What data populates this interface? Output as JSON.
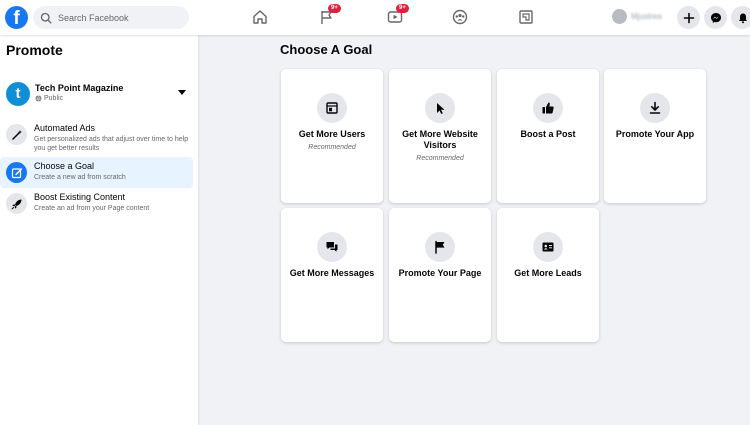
{
  "topbar": {
    "search_placeholder": "Search Facebook",
    "logo_letter": "f",
    "notifications_pages": "9+",
    "notifications_watch": "9+",
    "profile_name": "Mjustrea",
    "accent": "#1877f2"
  },
  "sidebar": {
    "title": "Promote",
    "page": {
      "name": "Tech Point Magazine",
      "avatar_letter": "t",
      "visibility": "Public"
    },
    "items": [
      {
        "label": "Automated Ads",
        "desc": "Get personalized ads that adjust over time to help you get better results",
        "icon": "wand-icon"
      },
      {
        "label": "Choose a Goal",
        "desc": "Create a new ad from scratch",
        "icon": "edit-icon"
      },
      {
        "label": "Boost Existing Content",
        "desc": "Create an ad from your Page content",
        "icon": "rocket-icon"
      }
    ]
  },
  "main": {
    "title": "Choose A Goal",
    "cards": [
      {
        "label": "Get More Users",
        "note": "Recommended",
        "icon": "app-window-icon"
      },
      {
        "label": "Get More Website Visitors",
        "note": "Recommended",
        "icon": "cursor-icon"
      },
      {
        "label": "Boost a Post",
        "note": "",
        "icon": "thumbs-up-icon"
      },
      {
        "label": "Promote Your App",
        "note": "",
        "icon": "download-icon"
      },
      {
        "label": "Get More Messages",
        "note": "",
        "icon": "chat-bubbles-icon"
      },
      {
        "label": "Promote Your Page",
        "note": "",
        "icon": "flag-icon"
      },
      {
        "label": "Get More Leads",
        "note": "",
        "icon": "id-card-icon"
      }
    ]
  }
}
